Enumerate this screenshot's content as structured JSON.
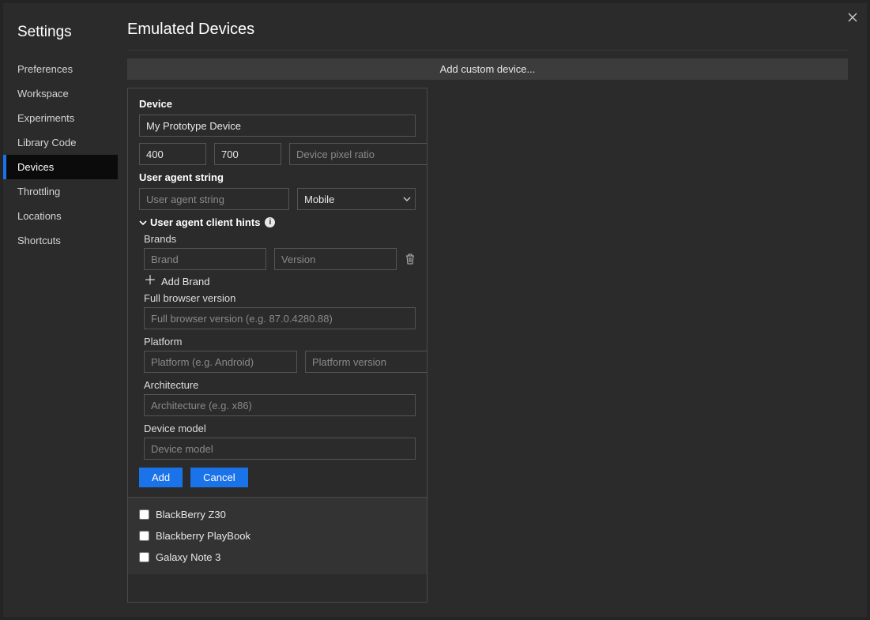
{
  "sidebar": {
    "title": "Settings",
    "items": [
      {
        "label": "Preferences"
      },
      {
        "label": "Workspace"
      },
      {
        "label": "Experiments"
      },
      {
        "label": "Library Code"
      },
      {
        "label": "Devices",
        "selected": true
      },
      {
        "label": "Throttling"
      },
      {
        "label": "Locations"
      },
      {
        "label": "Shortcuts"
      }
    ]
  },
  "main": {
    "title": "Emulated Devices",
    "add_custom_label": "Add custom device..."
  },
  "editor": {
    "device_section": "Device",
    "device_name_value": "My Prototype Device",
    "width_value": "400",
    "height_value": "700",
    "dpr_placeholder": "Device pixel ratio",
    "ua_section": "User agent string",
    "ua_placeholder": "User agent string",
    "ua_type_selected": "Mobile",
    "hints": {
      "header": "User agent client hints",
      "brands_label": "Brands",
      "brand_placeholder": "Brand",
      "version_placeholder": "Version",
      "add_brand_label": "Add Brand",
      "full_browser_label": "Full browser version",
      "full_browser_placeholder": "Full browser version (e.g. 87.0.4280.88)",
      "platform_label": "Platform",
      "platform_placeholder": "Platform (e.g. Android)",
      "platform_version_placeholder": "Platform version",
      "arch_label": "Architecture",
      "arch_placeholder": "Architecture (e.g. x86)",
      "model_label": "Device model",
      "model_placeholder": "Device model"
    },
    "add_label": "Add",
    "cancel_label": "Cancel"
  },
  "device_list": [
    {
      "label": "BlackBerry Z30",
      "checked": false
    },
    {
      "label": "Blackberry PlayBook",
      "checked": false
    },
    {
      "label": "Galaxy Note 3",
      "checked": false
    }
  ]
}
